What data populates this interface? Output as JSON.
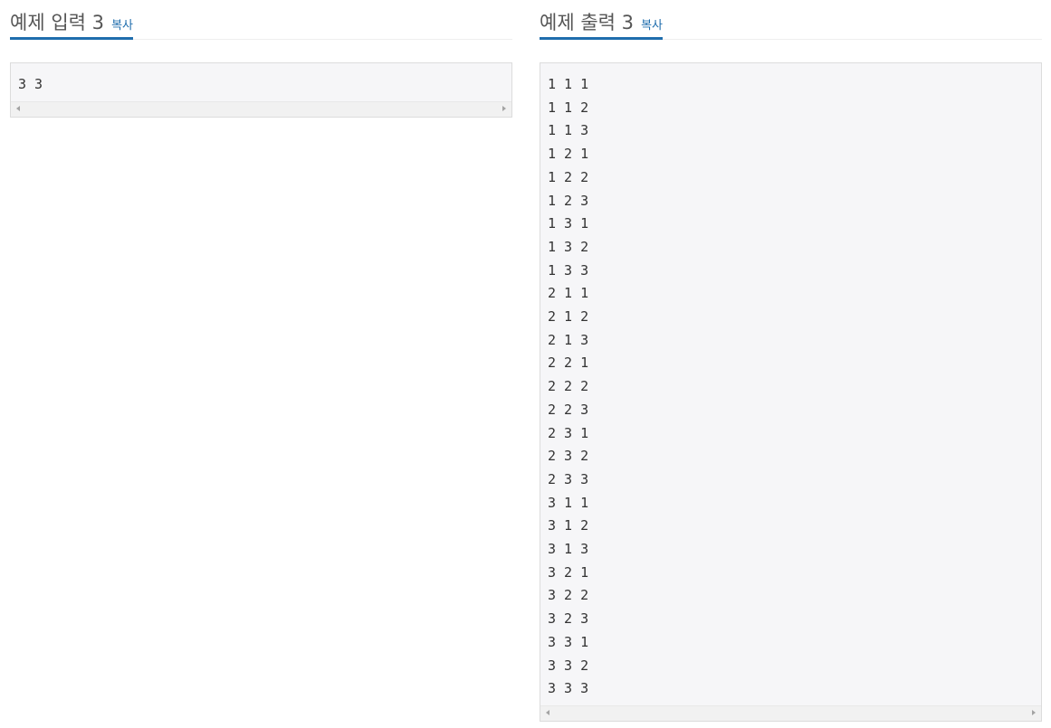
{
  "input_panel": {
    "title": "예제 입력 3",
    "copy_label": "복사",
    "content": "3 3"
  },
  "output_panel": {
    "title": "예제 출력 3",
    "copy_label": "복사",
    "content": "1 1 1\n1 1 2\n1 1 3\n1 2 1\n1 2 2\n1 2 3\n1 3 1\n1 3 2\n1 3 3\n2 1 1\n2 1 2\n2 1 3\n2 2 1\n2 2 2\n2 2 3\n2 3 1\n2 3 2\n2 3 3\n3 1 1\n3 1 2\n3 1 3\n3 2 1\n3 2 2\n3 2 3\n3 3 1\n3 3 2\n3 3 3"
  },
  "colors": {
    "accent": "#1f6dad",
    "title_text": "#555555",
    "code_background": "#f6f6f8",
    "code_border": "#dcdcdc"
  }
}
